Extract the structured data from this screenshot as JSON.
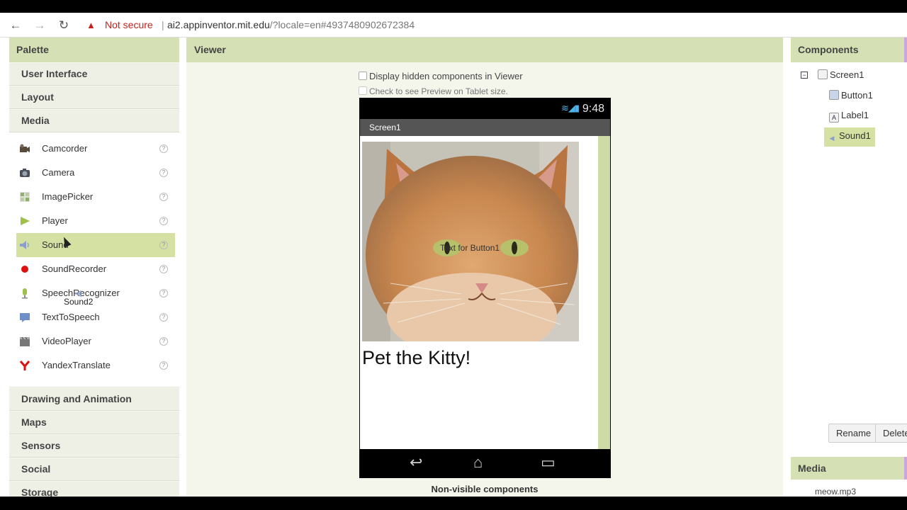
{
  "browser": {
    "back": "←",
    "forward": "→",
    "reload": "↻",
    "security_label": "Not secure",
    "url_host": "ai2.appinventor.mit.edu",
    "url_path": "/?locale=en#4937480902672384"
  },
  "palette": {
    "title": "Palette",
    "categories_top": [
      "User Interface",
      "Layout",
      "Media"
    ],
    "media_items": [
      {
        "label": "Camcorder",
        "icon": "camcorder-icon"
      },
      {
        "label": "Camera",
        "icon": "camera-icon"
      },
      {
        "label": "ImagePicker",
        "icon": "imagepicker-icon"
      },
      {
        "label": "Player",
        "icon": "player-icon"
      },
      {
        "label": "Sound",
        "icon": "sound-icon"
      },
      {
        "label": "SoundRecorder",
        "icon": "soundrecorder-icon"
      },
      {
        "label": "SpeechRecognizer",
        "icon": "speechrecognizer-icon"
      },
      {
        "label": "TextToSpeech",
        "icon": "texttospeech-icon"
      },
      {
        "label": "VideoPlayer",
        "icon": "videoplayer-icon"
      },
      {
        "label": "YandexTranslate",
        "icon": "yandextranslate-icon"
      }
    ],
    "help_glyph": "?",
    "drag_ghost": "Sound2",
    "categories_bottom": [
      "Drawing and Animation",
      "Maps",
      "Sensors",
      "Social",
      "Storage"
    ]
  },
  "viewer": {
    "title": "Viewer",
    "checkbox_hidden": "Display hidden components in Viewer",
    "checkbox_tablet": "Check to see Preview on Tablet size.",
    "time": "9:48",
    "screen_title": "Screen1",
    "button_text": "Text for Button1",
    "label_text": "Pet the Kitty!",
    "nonvisible": "Non-visible components"
  },
  "components": {
    "title": "Components",
    "tree": [
      "Screen1",
      "Button1",
      "Label1",
      "Sound1"
    ],
    "rename": "Rename",
    "delete": "Delete"
  },
  "media": {
    "title": "Media",
    "file": "meow.mp3"
  },
  "colors": {
    "header_green": "#d5e1b4",
    "selected_green": "#d5e1a3",
    "not_secure_red": "#c5221f"
  }
}
